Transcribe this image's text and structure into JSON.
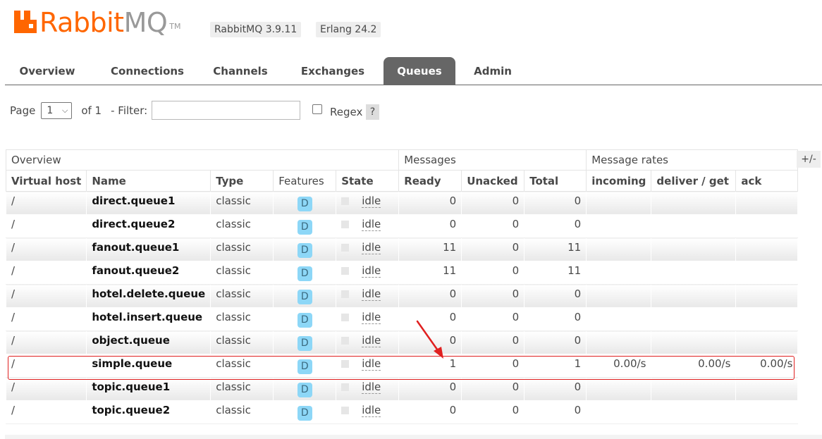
{
  "header": {
    "logo_rabbit": "Rabbit",
    "logo_mq": "MQ",
    "logo_tm": "TM",
    "rabbitmq_version": "RabbitMQ 3.9.11",
    "erlang_version": "Erlang 24.2"
  },
  "tabs": [
    {
      "label": "Overview"
    },
    {
      "label": "Connections"
    },
    {
      "label": "Channels"
    },
    {
      "label": "Exchanges"
    },
    {
      "label": "Queues",
      "active": true
    },
    {
      "label": "Admin"
    }
  ],
  "paging": {
    "page_label": "Page",
    "page_value": "1",
    "of_label": "of 1",
    "filter_label": "- Filter:",
    "filter_value": "",
    "regex_label": "Regex",
    "regex_checked": false,
    "help": "?"
  },
  "table": {
    "groups": {
      "overview": "Overview",
      "messages": "Messages",
      "rates": "Message rates"
    },
    "columns": {
      "vhost": "Virtual host",
      "name": "Name",
      "type": "Type",
      "features": "Features",
      "state": "State",
      "ready": "Ready",
      "unacked": "Unacked",
      "total": "Total",
      "incoming": "incoming",
      "deliver": "deliver / get",
      "ack": "ack"
    },
    "plus_minus": "+/-",
    "rows": [
      {
        "vhost": "/",
        "name": "direct.queue1",
        "type": "classic",
        "feature": "D",
        "state": "idle",
        "ready": "0",
        "unacked": "0",
        "total": "0",
        "incoming": "",
        "deliver": "",
        "ack": ""
      },
      {
        "vhost": "/",
        "name": "direct.queue2",
        "type": "classic",
        "feature": "D",
        "state": "idle",
        "ready": "0",
        "unacked": "0",
        "total": "0",
        "incoming": "",
        "deliver": "",
        "ack": ""
      },
      {
        "vhost": "/",
        "name": "fanout.queue1",
        "type": "classic",
        "feature": "D",
        "state": "idle",
        "ready": "11",
        "unacked": "0",
        "total": "11",
        "incoming": "",
        "deliver": "",
        "ack": ""
      },
      {
        "vhost": "/",
        "name": "fanout.queue2",
        "type": "classic",
        "feature": "D",
        "state": "idle",
        "ready": "11",
        "unacked": "0",
        "total": "11",
        "incoming": "",
        "deliver": "",
        "ack": ""
      },
      {
        "vhost": "/",
        "name": "hotel.delete.queue",
        "type": "classic",
        "feature": "D",
        "state": "idle",
        "ready": "0",
        "unacked": "0",
        "total": "0",
        "incoming": "",
        "deliver": "",
        "ack": ""
      },
      {
        "vhost": "/",
        "name": "hotel.insert.queue",
        "type": "classic",
        "feature": "D",
        "state": "idle",
        "ready": "0",
        "unacked": "0",
        "total": "0",
        "incoming": "",
        "deliver": "",
        "ack": ""
      },
      {
        "vhost": "/",
        "name": "object.queue",
        "type": "classic",
        "feature": "D",
        "state": "idle",
        "ready": "0",
        "unacked": "0",
        "total": "0",
        "incoming": "",
        "deliver": "",
        "ack": ""
      },
      {
        "vhost": "/",
        "name": "simple.queue",
        "type": "classic",
        "feature": "D",
        "state": "idle",
        "ready": "1",
        "unacked": "0",
        "total": "1",
        "incoming": "0.00/s",
        "deliver": "0.00/s",
        "ack": "0.00/s"
      },
      {
        "vhost": "/",
        "name": "topic.queue1",
        "type": "classic",
        "feature": "D",
        "state": "idle",
        "ready": "0",
        "unacked": "0",
        "total": "0",
        "incoming": "",
        "deliver": "",
        "ack": ""
      },
      {
        "vhost": "/",
        "name": "topic.queue2",
        "type": "classic",
        "feature": "D",
        "state": "idle",
        "ready": "0",
        "unacked": "0",
        "total": "0",
        "incoming": "",
        "deliver": "",
        "ack": ""
      }
    ]
  },
  "colors": {
    "brand": "#ff6600",
    "tab_active": "#666666",
    "feature_badge": "#8dd7f7",
    "annotation": "#e02020"
  },
  "icons": {
    "logo": "rabbitmq-logo-icon",
    "select": "chevron-down-icon",
    "annotation": "red-arrow-icon"
  }
}
